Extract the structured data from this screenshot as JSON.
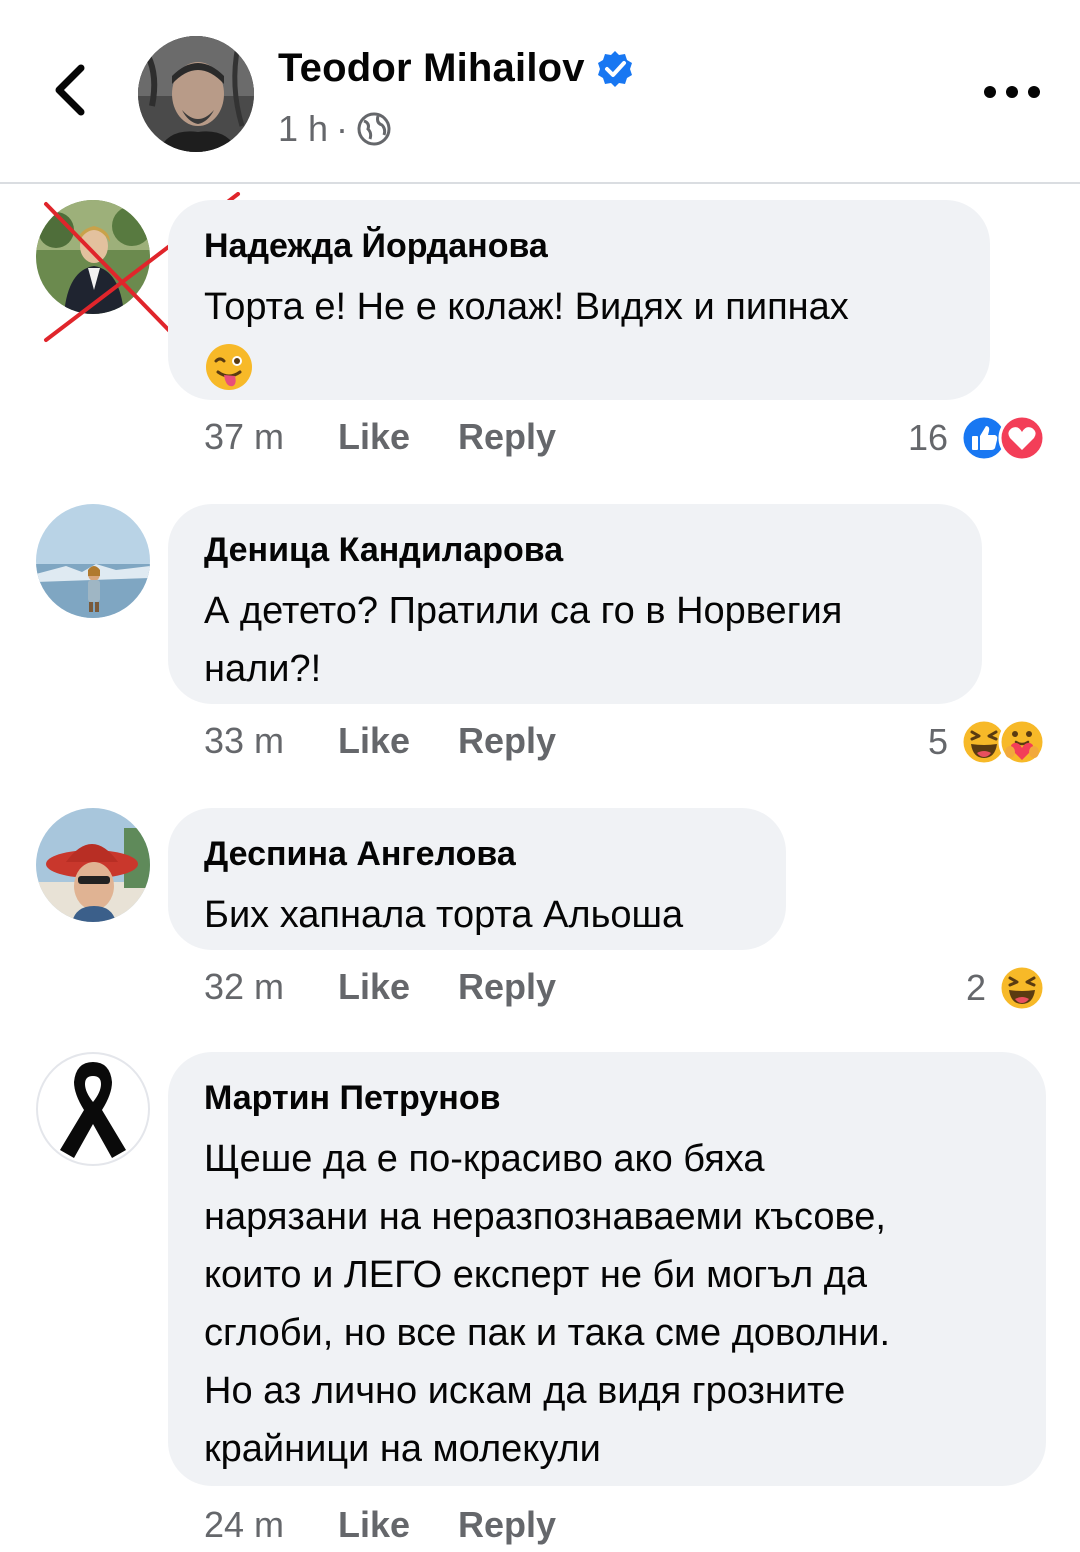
{
  "header": {
    "author_name": "Teodor Mihailov",
    "time": "1 h",
    "separator": "·",
    "verified": true,
    "icons": [
      "back-chevron-icon",
      "verified-badge-icon",
      "globe-icon",
      "more-dots-icon"
    ]
  },
  "comments": [
    {
      "name": "Надежда Йорданова",
      "text": "Торта е! Не е колаж! Видях и пипнах",
      "emoji": "😜",
      "time": "37 m",
      "like_label": "Like",
      "reply_label": "Reply",
      "reaction_count": "16",
      "reactions": [
        "like-reaction-icon",
        "love-reaction-icon"
      ],
      "avatar_crossed_out": true
    },
    {
      "name": "Деница Кандиларова",
      "text_line1": "А детето? Пратили са го в Норвегия",
      "text_line2": "нали?!",
      "time": "33 m",
      "like_label": "Like",
      "reply_label": "Reply",
      "reaction_count": "5",
      "reactions": [
        "haha-reaction-icon",
        "care-reaction-icon"
      ]
    },
    {
      "name": "Деспина Ангелова",
      "text": "Бих хапнала торта Альоша",
      "time": "32 m",
      "like_label": "Like",
      "reply_label": "Reply",
      "reaction_count": "2",
      "reactions": [
        "haha-reaction-icon"
      ]
    },
    {
      "name": "Мартин Петрунов",
      "lines": [
        "Щеше да е по-красиво ако бяха",
        "нарязани на неразпознаваеми късове,",
        "които и ЛЕГО експерт не би могъл да",
        "сглоби, но все пак и така сме доволни.",
        "Но аз лично искам да видя грозните",
        "крайници на молекули"
      ],
      "time": "24 m",
      "like_label": "Like",
      "reply_label": "Reply"
    }
  ],
  "colors": {
    "bubble": "#f0f2f5",
    "meta_text": "#65676b",
    "facebook_blue": "#1877f2",
    "love_red": "#f33e58",
    "haha_yellow": "#f7b928",
    "cross_red": "#e0252b"
  }
}
